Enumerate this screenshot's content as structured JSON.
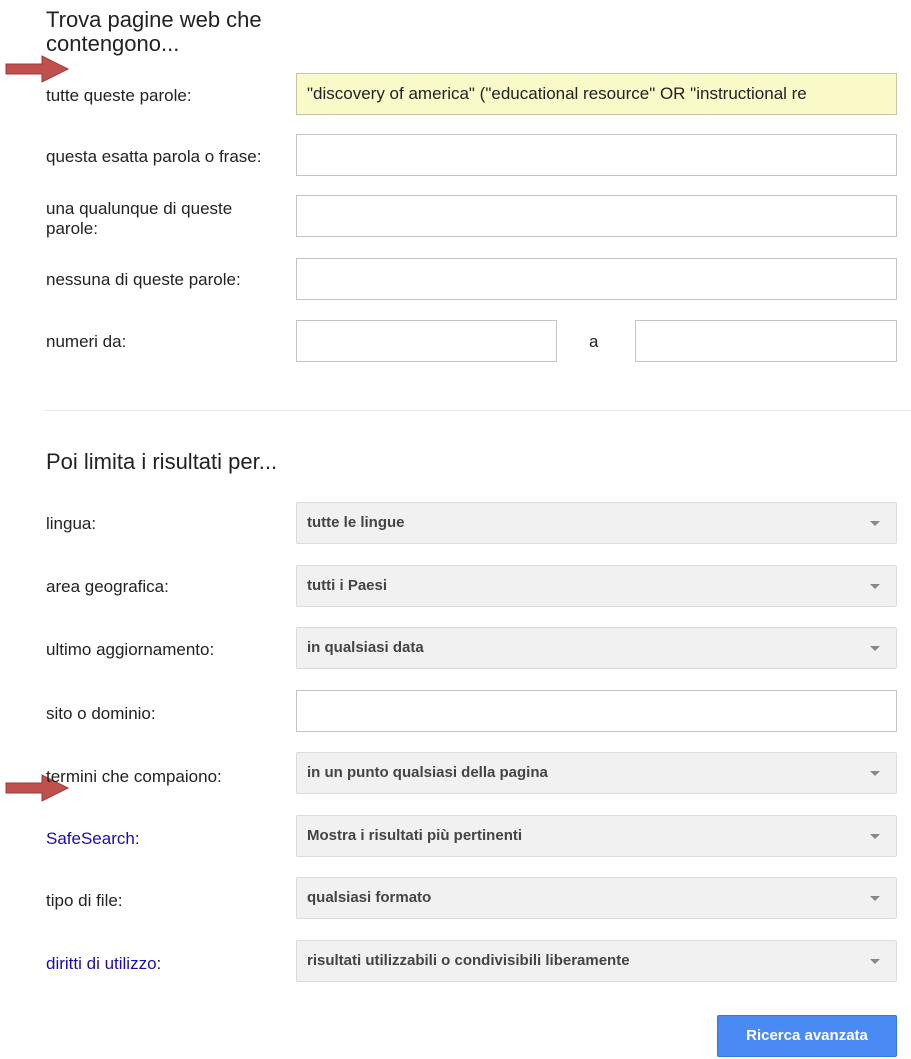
{
  "find_section": {
    "title": "Trova pagine web che contengono...",
    "all_words_label": "tutte queste parole:",
    "all_words_value": "\"discovery of america\" (\"educational resource\" OR \"instructional re",
    "exact_phrase_label": "questa esatta parola o frase:",
    "exact_phrase_value": "",
    "any_words_label": "una qualunque di queste parole:",
    "any_words_value": "",
    "none_words_label": "nessuna di queste parole:",
    "none_words_value": "",
    "numbers_label": "numeri da:",
    "numbers_from_value": "",
    "numbers_to_label": "a",
    "numbers_to_value": ""
  },
  "narrow_section": {
    "title": "Poi limita i risultati per...",
    "language_label": "lingua:",
    "language_value": "tutte le lingue",
    "region_label": "area geografica:",
    "region_value": "tutti i Paesi",
    "last_update_label": "ultimo aggiornamento:",
    "last_update_value": "in qualsiasi data",
    "site_label": "sito o dominio:",
    "site_value": "",
    "terms_label": "termini che compaiono:",
    "terms_value": "in un punto qualsiasi della pagina",
    "safesearch_label": "SafeSearch",
    "safesearch_value": "Mostra i risultati più pertinenti",
    "filetype_label": "tipo di file:",
    "filetype_value": "qualsiasi formato",
    "usage_rights_label": "diritti di utilizzo",
    "usage_rights_value": "risultati utilizzabili o condivisibili liberamente",
    "colon": ":"
  },
  "submit_button": {
    "label": "Ricerca avanzata"
  },
  "colors": {
    "link": "#1a0dab",
    "highlight_field": "#fafac8",
    "button_blue": "#4a8af4",
    "annotation_arrow": "#c0504d"
  },
  "icons": {
    "annotation_arrow": "right-arrow-icon",
    "dropdown": "chevron-down-icon"
  }
}
